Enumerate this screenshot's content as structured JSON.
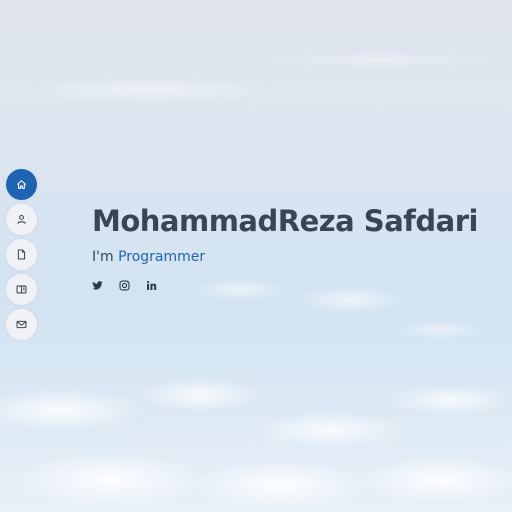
{
  "nav": {
    "items": [
      {
        "icon": "home-icon",
        "active": true
      },
      {
        "icon": "person-icon",
        "active": false
      },
      {
        "icon": "file-icon",
        "active": false
      },
      {
        "icon": "book-icon",
        "active": false
      },
      {
        "icon": "envelope-icon",
        "active": false
      }
    ],
    "active_color": "#1f64b3"
  },
  "hero": {
    "name": "MohammadReza Safdari",
    "prefix": "I'm",
    "role": "Programmer",
    "accent_color": "#1f64b3",
    "text_color": "#3a4553"
  },
  "social": [
    {
      "icon": "twitter-icon"
    },
    {
      "icon": "instagram-icon"
    },
    {
      "icon": "linkedin-icon"
    }
  ]
}
